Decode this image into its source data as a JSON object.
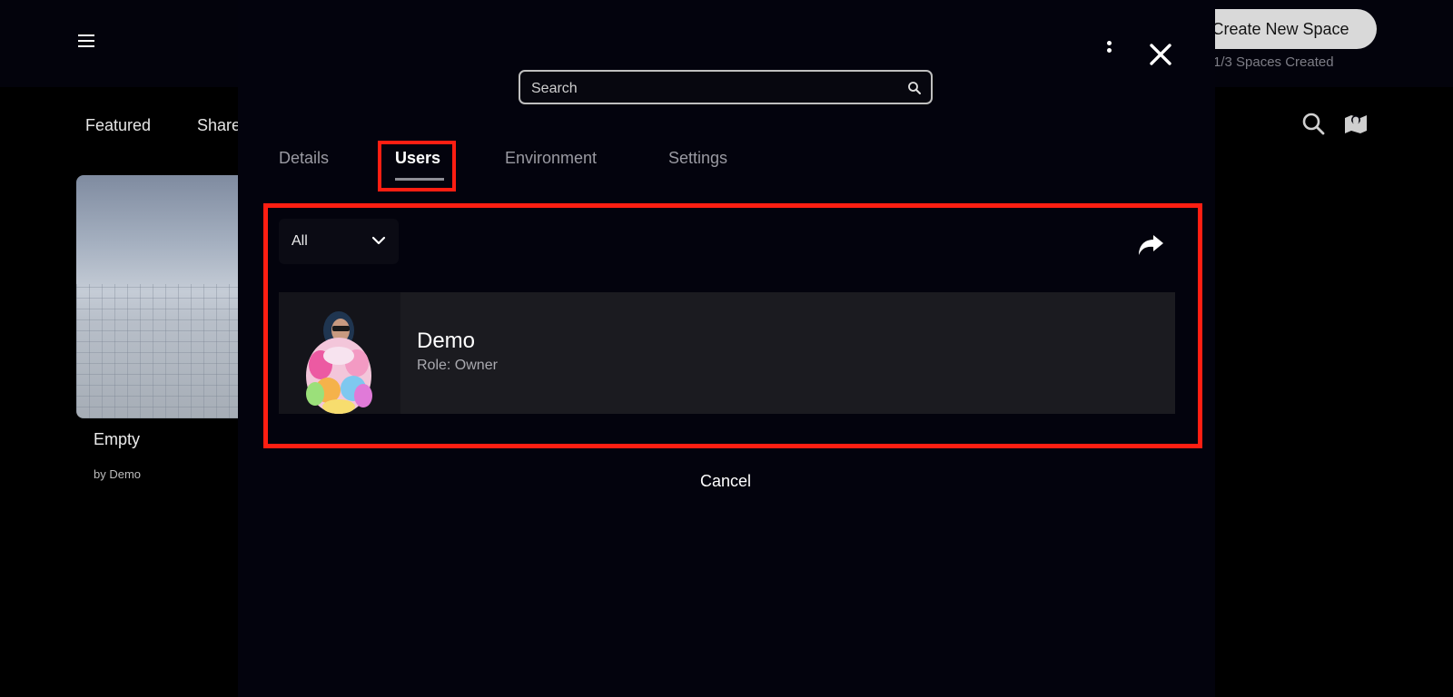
{
  "background": {
    "create_button_label": "Create New Space",
    "spaces_count": "1/3 Spaces Created",
    "tabs": [
      {
        "label": "Featured"
      },
      {
        "label": "Share"
      }
    ],
    "card": {
      "title": "Empty",
      "author": "by Demo"
    },
    "icons": [
      "hamburger-menu-icon",
      "search-icon",
      "map-icon"
    ]
  },
  "modal": {
    "search": {
      "placeholder": "Search",
      "value": ""
    },
    "tabs": [
      {
        "label": "Details",
        "active": false
      },
      {
        "label": "Users",
        "active": true
      },
      {
        "label": "Environment",
        "active": false
      },
      {
        "label": "Settings",
        "active": false
      }
    ],
    "filter": {
      "selected": "All"
    },
    "users": [
      {
        "name": "Demo",
        "role": "Role: Owner"
      }
    ],
    "cancel_label": "Cancel",
    "icons": [
      "more-options-icon",
      "close-icon",
      "share-icon",
      "chevron-down-icon"
    ]
  },
  "colors": {
    "background": "#000000",
    "modal": "#03030d",
    "highlight": "#ff1e12",
    "row": "#1b1b20",
    "button": "#d9d9d9"
  }
}
